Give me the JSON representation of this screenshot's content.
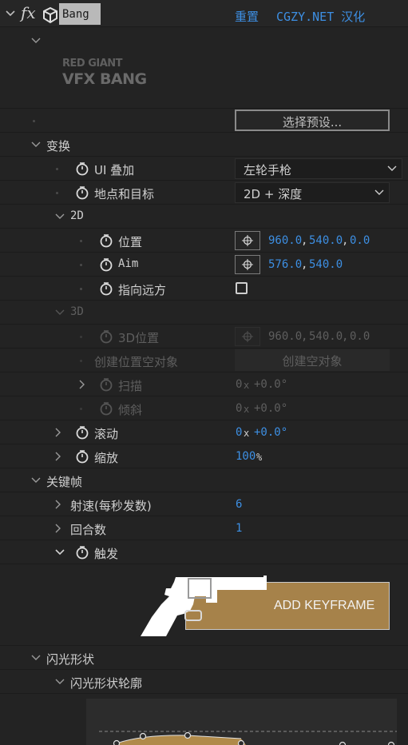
{
  "header": {
    "fx_label": "fx",
    "effect_name": "Bang",
    "reset": "重置",
    "credit": "CGZY.NET 汉化"
  },
  "logo": {
    "line1": "RED GIANT",
    "line2": "VFX BANG"
  },
  "preset_button": "选择预设...",
  "transform": {
    "label": "变换",
    "ui_overlay": {
      "label": "UI 叠加",
      "value": "左轮手枪"
    },
    "location_target": {
      "label": "地点和目标",
      "value": "2D + 深度"
    },
    "two_d": {
      "label": "2D",
      "position": {
        "label": "位置",
        "x": "960.0",
        "y": "540.0",
        "z": "0.0"
      },
      "aim": {
        "label": "Aim",
        "x": "576.0",
        "y": "540.0"
      },
      "point_far": {
        "label": "指向远方"
      }
    },
    "three_d": {
      "label": "3D",
      "position3d": {
        "label": "3D位置",
        "x": "960.0",
        "y": "540.0",
        "z": "0.0"
      },
      "create_null": {
        "label": "创建位置空对象",
        "button": "创建空对象"
      },
      "pan": {
        "label": "扫描",
        "turns": "0",
        "x": "x",
        "deg": "+0.0°"
      },
      "tilt": {
        "label": "倾斜",
        "turns": "0",
        "x": "x",
        "deg": "+0.0°"
      }
    },
    "roll": {
      "label": "滚动",
      "turns": "0",
      "x": "x",
      "deg": "+0.0°"
    },
    "scale": {
      "label": "缩放",
      "value": "100",
      "unit": "%"
    }
  },
  "keyframes": {
    "label": "关键帧",
    "fire_rate": {
      "label": "射速(每秒发数)",
      "value": "6"
    },
    "rounds": {
      "label": "回合数",
      "value": "1"
    },
    "trigger": {
      "label": "触发"
    },
    "add_keyframe": "ADD KEYFRAME"
  },
  "flash_shape": {
    "label": "闪光形状",
    "profile": {
      "label": "闪光形状轮廓"
    }
  },
  "colors": {
    "accent_blue": "#3d8fe3",
    "gold": "#a6824a",
    "bg": "#232323"
  }
}
